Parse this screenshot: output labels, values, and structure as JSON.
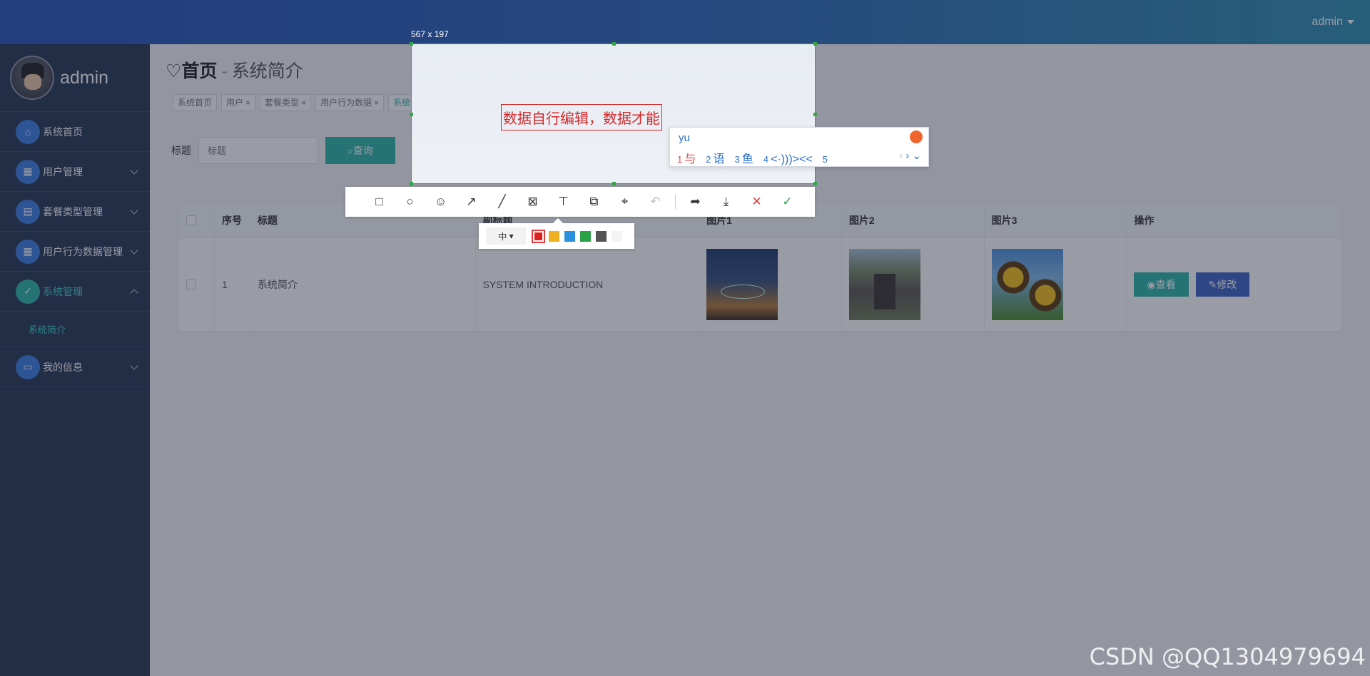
{
  "header": {
    "user": "admin"
  },
  "sidebar": {
    "user_name": "admin",
    "items": [
      {
        "label": "系统首页"
      },
      {
        "label": "用户管理"
      },
      {
        "label": "套餐类型管理"
      },
      {
        "label": "用户行为数据管理"
      },
      {
        "label": "系统管理"
      },
      {
        "label": "我的信息"
      }
    ],
    "submenu_label": "系统简介"
  },
  "main": {
    "title_home": "首页",
    "title_sep": "-",
    "title_sub": "系统简介",
    "tabs": [
      {
        "label": "系统首页",
        "closable": false
      },
      {
        "label": "用户",
        "closable": true
      },
      {
        "label": "套餐类型",
        "closable": true
      },
      {
        "label": "用户行为数据",
        "closable": true
      },
      {
        "label": "系统简介",
        "closable": true,
        "active": true
      }
    ],
    "search": {
      "label": "标题",
      "placeholder": "标题",
      "button": "查询"
    },
    "table": {
      "headers": [
        "序号",
        "标题",
        "副标题",
        "图片1",
        "图片2",
        "图片3",
        "操作"
      ],
      "rows": [
        {
          "index": "1",
          "title": "系统简介",
          "subtitle": "SYSTEM INTRODUCTION"
        }
      ],
      "view_button": "查看",
      "edit_button": "修改"
    }
  },
  "capture_tool": {
    "size_label": "567 x 197",
    "annotation_text": "数据自行编辑，数据才能",
    "ime": {
      "typed": "yu",
      "candidates": [
        {
          "num": "1",
          "text": "与"
        },
        {
          "num": "2",
          "text": "语"
        },
        {
          "num": "3",
          "text": "鱼"
        },
        {
          "num": "4",
          "text": "<·)))><<"
        },
        {
          "num": "5",
          "text": ""
        }
      ]
    },
    "font_size_option": "中",
    "colors": [
      "#e02020",
      "#f0b020",
      "#2a90e0",
      "#2aa146",
      "#555555",
      "#f4f4f4"
    ]
  },
  "watermark": "CSDN @QQ1304979694",
  "colors": {
    "accent": "#2db5a8",
    "sidebar_bg": "#263552",
    "topbar": "#2752b6"
  }
}
